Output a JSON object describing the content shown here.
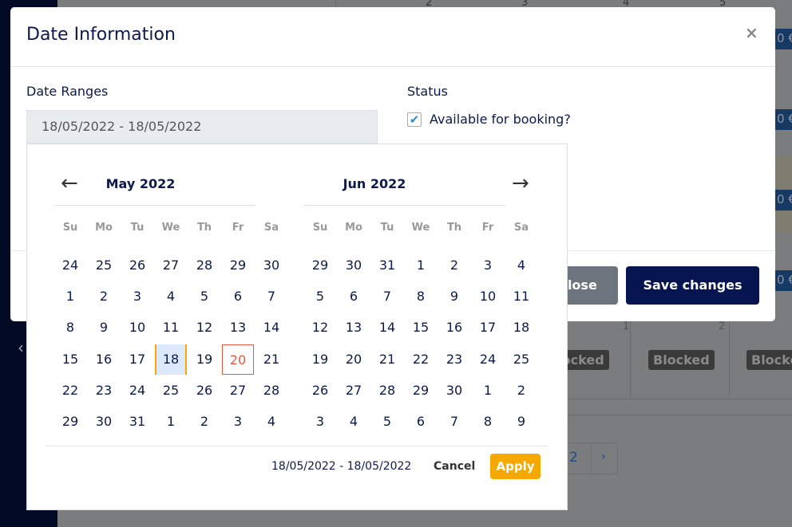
{
  "background": {
    "header_days": [
      "2",
      "3",
      "4",
      "5"
    ],
    "price_label": "0 €",
    "cell_days": [
      "1",
      "2"
    ],
    "blocked_label": "Blocked",
    "pagination": {
      "page": "2",
      "next": "›"
    },
    "sidebar_toggle": "‹"
  },
  "modal": {
    "title": "Date Information",
    "close_icon": "×",
    "date_ranges_label": "Date Ranges",
    "date_ranges_value": "18/05/2022 - 18/05/2022",
    "status_label": "Status",
    "available_label": "Available for booking?",
    "available_checked": true,
    "close_button": "Close",
    "save_button": "Save changes"
  },
  "datepicker": {
    "prev_icon": "←",
    "next_icon": "→",
    "weekdays": [
      "Su",
      "Mo",
      "Tu",
      "We",
      "Th",
      "Fr",
      "Sa"
    ],
    "months": [
      {
        "title": "May 2022",
        "days": [
          [
            "24",
            "25",
            "26",
            "27",
            "28",
            "29",
            "30"
          ],
          [
            "1",
            "2",
            "3",
            "4",
            "5",
            "6",
            "7"
          ],
          [
            "8",
            "9",
            "10",
            "11",
            "12",
            "13",
            "14"
          ],
          [
            "15",
            "16",
            "17",
            "18",
            "19",
            "20",
            "21"
          ],
          [
            "22",
            "23",
            "24",
            "25",
            "26",
            "27",
            "28"
          ],
          [
            "29",
            "30",
            "31",
            "1",
            "2",
            "3",
            "4"
          ]
        ]
      },
      {
        "title": "Jun 2022",
        "days": [
          [
            "29",
            "30",
            "31",
            "1",
            "2",
            "3",
            "4"
          ],
          [
            "5",
            "6",
            "7",
            "8",
            "9",
            "10",
            "11"
          ],
          [
            "12",
            "13",
            "14",
            "15",
            "16",
            "17",
            "18"
          ],
          [
            "19",
            "20",
            "21",
            "22",
            "23",
            "24",
            "25"
          ],
          [
            "26",
            "27",
            "28",
            "29",
            "30",
            "1",
            "2"
          ],
          [
            "3",
            "4",
            "5",
            "6",
            "7",
            "8",
            "9"
          ]
        ]
      }
    ],
    "selected": "18 May 2022",
    "today": "20 May 2022",
    "range_text": "18/05/2022 - 18/05/2022",
    "cancel_label": "Cancel",
    "apply_label": "Apply",
    "colors": {
      "accent": "#f5a800",
      "today": "#e8583e",
      "primary": "#06154f"
    }
  }
}
